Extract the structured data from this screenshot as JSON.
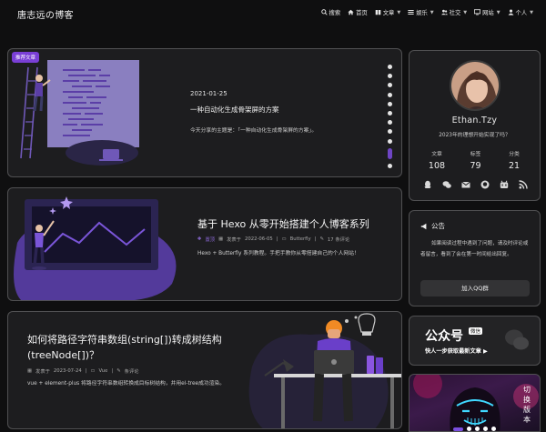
{
  "site": {
    "brand": "唐志远の博客"
  },
  "nav": {
    "items": [
      {
        "label": "搜索",
        "icon": "search-icon"
      },
      {
        "label": "首页",
        "icon": "home-icon"
      },
      {
        "label": "文章",
        "icon": "book-icon",
        "dropdown": true
      },
      {
        "label": "娱乐",
        "icon": "list-icon",
        "dropdown": true
      },
      {
        "label": "社交",
        "icon": "users-icon",
        "dropdown": true
      },
      {
        "label": "网站",
        "icon": "monitor-icon",
        "dropdown": true
      },
      {
        "label": "个人",
        "icon": "user-icon",
        "dropdown": true
      }
    ]
  },
  "featured": {
    "tag": "推荐文章",
    "date": "2021-01-25",
    "title": "一种自动化生成骨架屏的方案",
    "desc": "今天分享的主题是：「一种自动化生成骨架屏的方案」。",
    "carousel_count": 11,
    "carousel_active_index": 9
  },
  "posts": [
    {
      "title": "基于 Hexo 从零开始搭建个人博客系列",
      "pinned": "置顶",
      "published_prefix": "发表于",
      "date": "2022-06-05",
      "category": "Butterfly",
      "comments": "17 条评论",
      "desc": "Hexo + Butterfly 系列教程。手把手教你从零搭建自己的个人网站！"
    },
    {
      "title": "如何将路径字符串数组(string[])转成树结构(treeNode[])？",
      "published_prefix": "发表于",
      "date": "2023-07-24",
      "category": "Vue",
      "comments": "条评论",
      "desc": "vue + element-plus 将路径字符串数组转换成目标树结构，并用el-tree成功渲染。"
    }
  ],
  "profile": {
    "name": "Ethan.Tzy",
    "subtitle": "2023年的理想开始实现了吗？",
    "stats": [
      {
        "label": "文章",
        "value": "108"
      },
      {
        "label": "标签",
        "value": "79"
      },
      {
        "label": "分类",
        "value": "21"
      }
    ],
    "socials": [
      "qq-icon",
      "wechat-icon",
      "mail-icon",
      "github-icon",
      "bilibili-icon",
      "rss-icon"
    ]
  },
  "notice": {
    "title": "公告",
    "text": "如果阅读过程中遇到了问题，请及时评论或者留言，看到了会在第一时间给出回复。",
    "button": "加入QQ群"
  },
  "wechat": {
    "title": "公众号",
    "badge": "微信",
    "sub": "快人一步获取最新文章 ▶"
  },
  "banner": {
    "text": "切换版本"
  },
  "colors": {
    "accent": "#7a3fd6",
    "card_bg": "#1d1d1f",
    "page_bg": "#0f0f10"
  }
}
